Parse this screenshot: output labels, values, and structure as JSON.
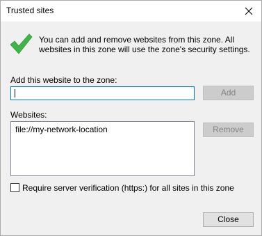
{
  "window": {
    "title": "Trusted sites"
  },
  "info": {
    "text": "You can add and remove websites from this zone. All websites in this zone will use the zone's security settings."
  },
  "add": {
    "label": "Add this website to the zone:",
    "input_value": "",
    "button_label": "Add",
    "button_enabled": false
  },
  "websites": {
    "label": "Websites:",
    "items": [
      "file://my-network-location"
    ],
    "remove_label": "Remove",
    "remove_enabled": false
  },
  "verification": {
    "label": "Require server verification (https:) for all sites in this zone",
    "checked": false
  },
  "footer": {
    "close_label": "Close"
  },
  "icons": {
    "check": "checkmark-icon",
    "close": "close-icon"
  },
  "colors": {
    "check_green": "#3fb44a",
    "focus_border": "#0078d7"
  }
}
